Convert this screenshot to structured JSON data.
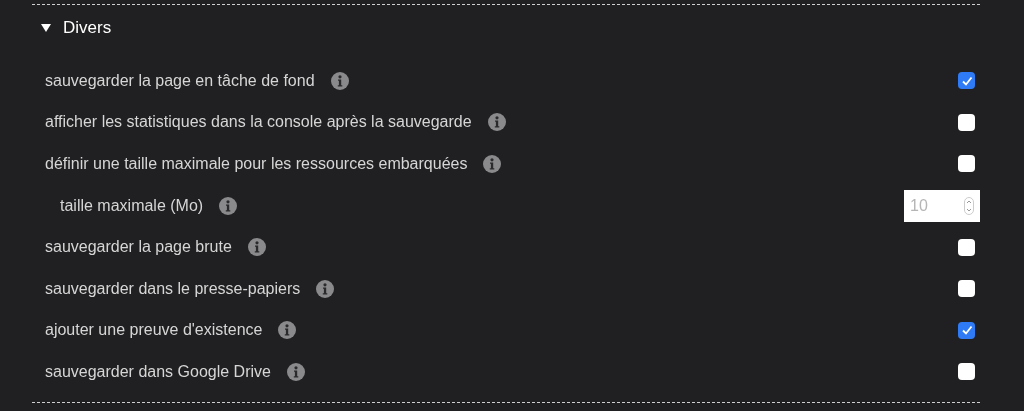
{
  "section": {
    "title": "Divers",
    "expanded": true
  },
  "options": [
    {
      "kind": "checkbox",
      "label": "sauvegarder la page en tâche de fond",
      "checked": true
    },
    {
      "kind": "checkbox",
      "label": "afficher les statistiques dans la console après la sauvegarde",
      "checked": false
    },
    {
      "kind": "checkbox",
      "label": "définir une taille maximale pour les ressources embarquées",
      "checked": false
    },
    {
      "kind": "number",
      "label": "taille maximale (Mo)",
      "value": "10",
      "disabled": true
    },
    {
      "kind": "checkbox",
      "label": "sauvegarder la page brute",
      "checked": false
    },
    {
      "kind": "checkbox",
      "label": "sauvegarder dans le presse-papiers",
      "checked": false
    },
    {
      "kind": "checkbox",
      "label": "ajouter une preuve d'existence",
      "checked": true
    },
    {
      "kind": "checkbox",
      "label": "sauvegarder dans Google Drive",
      "checked": false
    }
  ]
}
